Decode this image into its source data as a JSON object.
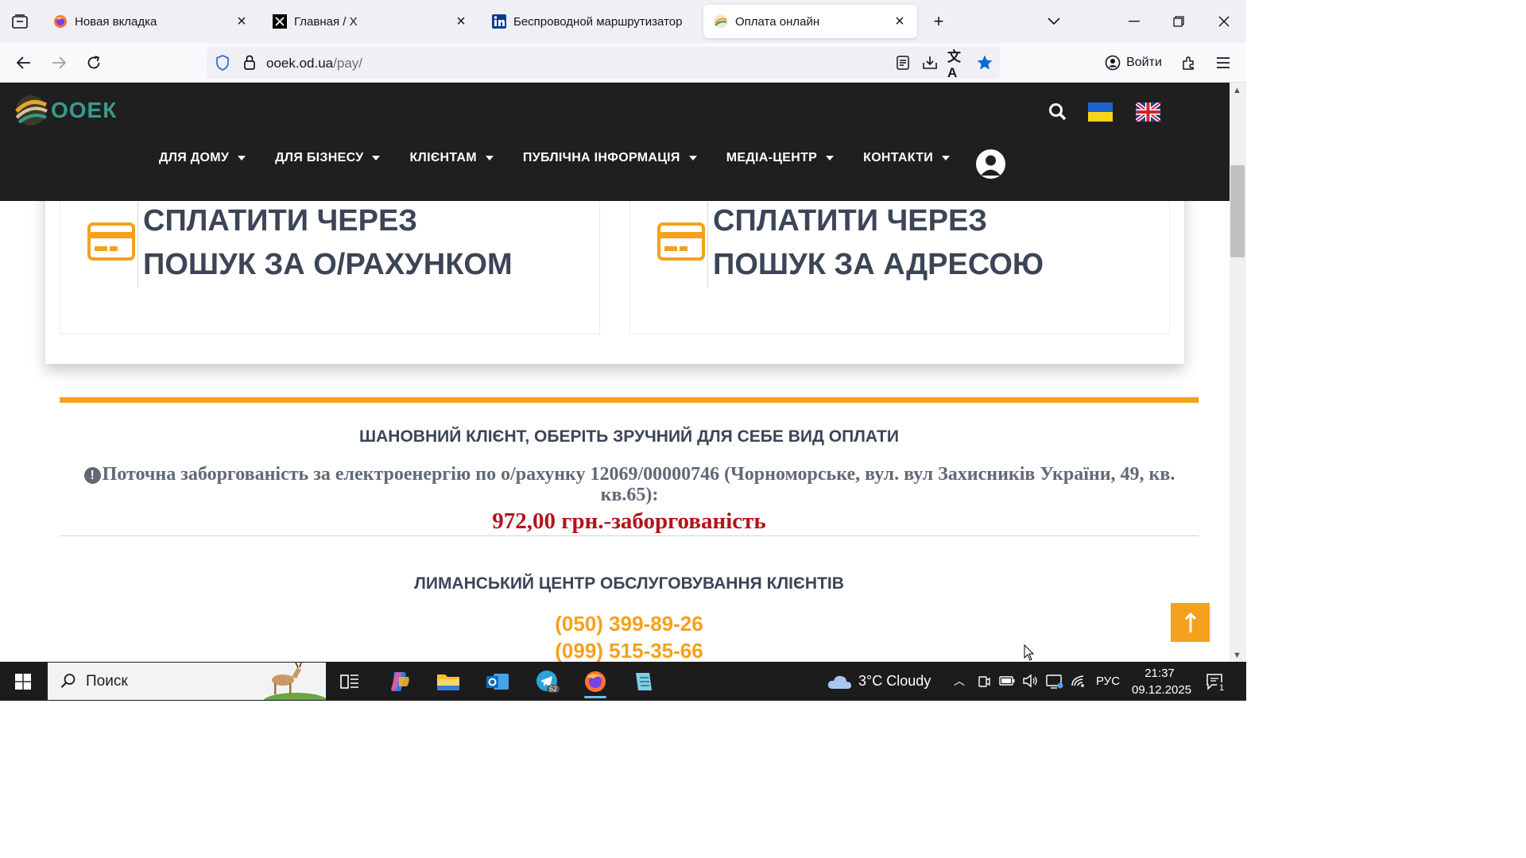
{
  "browser": {
    "tabs": [
      {
        "title": "Новая вкладка",
        "icon": "firefox-icon"
      },
      {
        "title": "Главная / X",
        "icon": "x-logo-icon"
      },
      {
        "title": "Беспроводной маршрутизатор",
        "icon": "linkedin-icon"
      },
      {
        "title": "Оплата онлайн",
        "icon": "ooek-favicon-icon",
        "active": true
      }
    ],
    "url_host": "ooek.od.ua",
    "url_path": "/pay/",
    "login_label": "Войти"
  },
  "site": {
    "logo_text": "ООЕК",
    "menu": [
      "ДЛЯ ДОМУ",
      "ДЛЯ БІЗНЕСУ",
      "КЛІЄНТАМ",
      "ПУБЛІЧНА ІНФОРМАЦІЯ",
      "МЕДІА-ЦЕНТР",
      "КОНТАКТИ"
    ]
  },
  "pay_options": [
    {
      "line1": "СПЛАТИТИ ЧЕРЕЗ",
      "line2": "ПОШУК ЗА О/РАХУНКОМ"
    },
    {
      "line1": "СПЛАТИТИ ЧЕРЕЗ",
      "line2": "ПОШУК ЗА АДРЕСОЮ"
    }
  ],
  "content": {
    "prompt": "ШАНОВНИЙ КЛІЄНТ, ОБЕРІТЬ ЗРУЧНИЙ ДЛЯ СЕБЕ ВИД ОПЛАТИ",
    "debt_text": "Поточна заборгованість за електроенергію по о/рахунку 12069/00000746 (Чорноморське, вул. вул Захисників України, 49, кв. кв.65):",
    "debt_amount": "972,00 грн.-заборгованість",
    "center_title": "ЛИМАНСЬКИЙ ЦЕНТР ОБСЛУГОВУВАННЯ КЛІЄНТІВ",
    "phones": [
      "(050) 399-89-26",
      "(099) 515-35-66"
    ]
  },
  "taskbar": {
    "search_label": "Поиск",
    "weather": "3°C  Cloudy",
    "language": "РУС",
    "time": "21:37",
    "date": "09.12.2025",
    "telegram_badge": "62",
    "notification_count": "1"
  },
  "colors": {
    "accent_orange": "#f5a11c",
    "debt_red": "#b3141b",
    "header_dark": "#1f1f1f",
    "text_slate": "#3b4557"
  }
}
